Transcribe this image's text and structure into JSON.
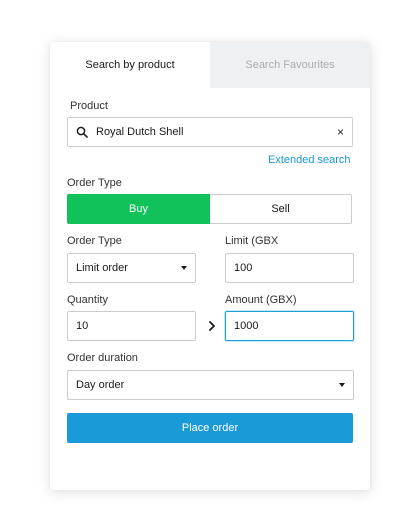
{
  "tabs": [
    {
      "label": "Search by product",
      "active": true
    },
    {
      "label": "Search Favourites",
      "active": false
    }
  ],
  "product": {
    "label": "Product",
    "value": "Royal Dutch Shell",
    "search_icon": "search-icon",
    "clear_glyph": "×",
    "extended_search": "Extended search"
  },
  "order_type_toggle": {
    "label": "Order Type",
    "options": [
      "Buy",
      "Sell"
    ],
    "selected": "Buy"
  },
  "order_type_select": {
    "label": "Order Type",
    "value": "Limit order"
  },
  "limit": {
    "label": "Limit (GBX",
    "value": "100"
  },
  "quantity": {
    "label": "Quantity",
    "value": "10"
  },
  "amount": {
    "label": "Amount (GBX)",
    "value": "1000"
  },
  "duration": {
    "label": "Order duration",
    "value": "Day order"
  },
  "place_order": "Place order",
  "colors": {
    "buy": "#11c25a",
    "accent": "#1a9ad6",
    "tab_inactive_bg": "#eef1f4"
  }
}
